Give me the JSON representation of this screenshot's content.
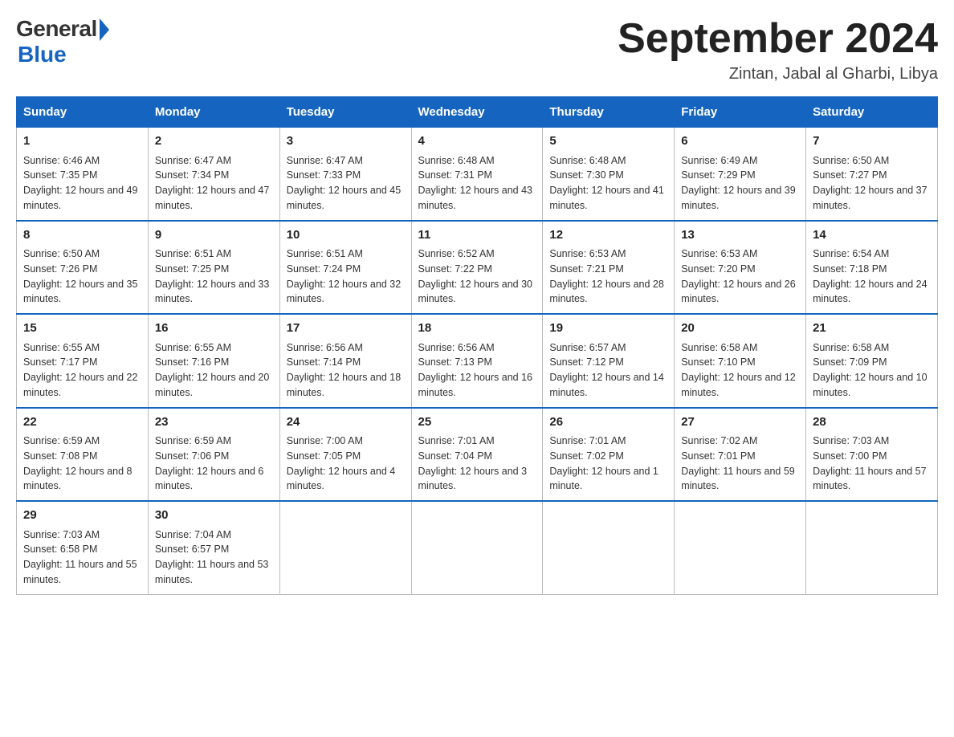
{
  "logo": {
    "general": "General",
    "blue": "Blue"
  },
  "title": "September 2024",
  "location": "Zintan, Jabal al Gharbi, Libya",
  "days_of_week": [
    "Sunday",
    "Monday",
    "Tuesday",
    "Wednesday",
    "Thursday",
    "Friday",
    "Saturday"
  ],
  "weeks": [
    [
      {
        "day": "1",
        "sunrise": "6:46 AM",
        "sunset": "7:35 PM",
        "daylight": "12 hours and 49 minutes."
      },
      {
        "day": "2",
        "sunrise": "6:47 AM",
        "sunset": "7:34 PM",
        "daylight": "12 hours and 47 minutes."
      },
      {
        "day": "3",
        "sunrise": "6:47 AM",
        "sunset": "7:33 PM",
        "daylight": "12 hours and 45 minutes."
      },
      {
        "day": "4",
        "sunrise": "6:48 AM",
        "sunset": "7:31 PM",
        "daylight": "12 hours and 43 minutes."
      },
      {
        "day": "5",
        "sunrise": "6:48 AM",
        "sunset": "7:30 PM",
        "daylight": "12 hours and 41 minutes."
      },
      {
        "day": "6",
        "sunrise": "6:49 AM",
        "sunset": "7:29 PM",
        "daylight": "12 hours and 39 minutes."
      },
      {
        "day": "7",
        "sunrise": "6:50 AM",
        "sunset": "7:27 PM",
        "daylight": "12 hours and 37 minutes."
      }
    ],
    [
      {
        "day": "8",
        "sunrise": "6:50 AM",
        "sunset": "7:26 PM",
        "daylight": "12 hours and 35 minutes."
      },
      {
        "day": "9",
        "sunrise": "6:51 AM",
        "sunset": "7:25 PM",
        "daylight": "12 hours and 33 minutes."
      },
      {
        "day": "10",
        "sunrise": "6:51 AM",
        "sunset": "7:24 PM",
        "daylight": "12 hours and 32 minutes."
      },
      {
        "day": "11",
        "sunrise": "6:52 AM",
        "sunset": "7:22 PM",
        "daylight": "12 hours and 30 minutes."
      },
      {
        "day": "12",
        "sunrise": "6:53 AM",
        "sunset": "7:21 PM",
        "daylight": "12 hours and 28 minutes."
      },
      {
        "day": "13",
        "sunrise": "6:53 AM",
        "sunset": "7:20 PM",
        "daylight": "12 hours and 26 minutes."
      },
      {
        "day": "14",
        "sunrise": "6:54 AM",
        "sunset": "7:18 PM",
        "daylight": "12 hours and 24 minutes."
      }
    ],
    [
      {
        "day": "15",
        "sunrise": "6:55 AM",
        "sunset": "7:17 PM",
        "daylight": "12 hours and 22 minutes."
      },
      {
        "day": "16",
        "sunrise": "6:55 AM",
        "sunset": "7:16 PM",
        "daylight": "12 hours and 20 minutes."
      },
      {
        "day": "17",
        "sunrise": "6:56 AM",
        "sunset": "7:14 PM",
        "daylight": "12 hours and 18 minutes."
      },
      {
        "day": "18",
        "sunrise": "6:56 AM",
        "sunset": "7:13 PM",
        "daylight": "12 hours and 16 minutes."
      },
      {
        "day": "19",
        "sunrise": "6:57 AM",
        "sunset": "7:12 PM",
        "daylight": "12 hours and 14 minutes."
      },
      {
        "day": "20",
        "sunrise": "6:58 AM",
        "sunset": "7:10 PM",
        "daylight": "12 hours and 12 minutes."
      },
      {
        "day": "21",
        "sunrise": "6:58 AM",
        "sunset": "7:09 PM",
        "daylight": "12 hours and 10 minutes."
      }
    ],
    [
      {
        "day": "22",
        "sunrise": "6:59 AM",
        "sunset": "7:08 PM",
        "daylight": "12 hours and 8 minutes."
      },
      {
        "day": "23",
        "sunrise": "6:59 AM",
        "sunset": "7:06 PM",
        "daylight": "12 hours and 6 minutes."
      },
      {
        "day": "24",
        "sunrise": "7:00 AM",
        "sunset": "7:05 PM",
        "daylight": "12 hours and 4 minutes."
      },
      {
        "day": "25",
        "sunrise": "7:01 AM",
        "sunset": "7:04 PM",
        "daylight": "12 hours and 3 minutes."
      },
      {
        "day": "26",
        "sunrise": "7:01 AM",
        "sunset": "7:02 PM",
        "daylight": "12 hours and 1 minute."
      },
      {
        "day": "27",
        "sunrise": "7:02 AM",
        "sunset": "7:01 PM",
        "daylight": "11 hours and 59 minutes."
      },
      {
        "day": "28",
        "sunrise": "7:03 AM",
        "sunset": "7:00 PM",
        "daylight": "11 hours and 57 minutes."
      }
    ],
    [
      {
        "day": "29",
        "sunrise": "7:03 AM",
        "sunset": "6:58 PM",
        "daylight": "11 hours and 55 minutes."
      },
      {
        "day": "30",
        "sunrise": "7:04 AM",
        "sunset": "6:57 PM",
        "daylight": "11 hours and 53 minutes."
      },
      null,
      null,
      null,
      null,
      null
    ]
  ]
}
